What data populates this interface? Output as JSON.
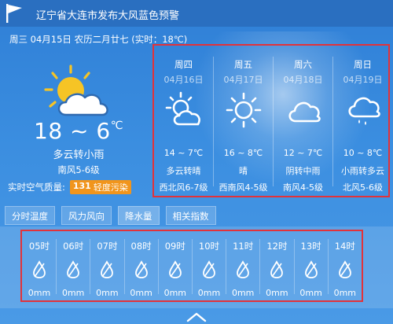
{
  "header": {
    "alert": "辽宁省大连市发布大风蓝色预警",
    "logo_icon": "pennant-flag-icon"
  },
  "date_line": "周三 04月15日 农历二月廿七 (实时：18℃)",
  "today": {
    "icon": "sun-behind-cloud-icon",
    "temp_low_high": "18 ~ 6",
    "unit": "℃",
    "condition": "多云转小雨",
    "wind": "南风5-6级",
    "aqi_label": "实时空气质量:",
    "aqi_value": "131",
    "aqi_level": "轻度污染",
    "aqi_color": "#f1951c"
  },
  "forecast": [
    {
      "weekday": "周四",
      "date": "04月16日",
      "icon": "partly-sunny-icon",
      "temp": "14 ~ 7℃",
      "condition": "多云转晴",
      "wind": "西北风6-7级"
    },
    {
      "weekday": "周五",
      "date": "04月17日",
      "icon": "sun-icon",
      "temp": "16 ~ 8℃",
      "condition": "晴",
      "wind": "西南风4-5级"
    },
    {
      "weekday": "周六",
      "date": "04月18日",
      "icon": "cloud-icon",
      "temp": "12 ~ 7℃",
      "condition": "阴转中雨",
      "wind": "南风4-5级"
    },
    {
      "weekday": "周日",
      "date": "04月19日",
      "icon": "cloud-rain-icon",
      "temp": "10 ~ 8℃",
      "condition": "小雨转多云",
      "wind": "北风5-6级"
    }
  ],
  "tabs": [
    {
      "label": "分时温度"
    },
    {
      "label": "风力风向"
    },
    {
      "label": "降水量"
    },
    {
      "label": "相关指数"
    }
  ],
  "active_tab": 2,
  "hourly": [
    {
      "hour": "05时",
      "value": "0mm"
    },
    {
      "hour": "06时",
      "value": "0mm"
    },
    {
      "hour": "07时",
      "value": "0mm"
    },
    {
      "hour": "08时",
      "value": "0mm"
    },
    {
      "hour": "09时",
      "value": "0mm"
    },
    {
      "hour": "10时",
      "value": "0mm"
    },
    {
      "hour": "11时",
      "value": "0mm"
    },
    {
      "hour": "12时",
      "value": "0mm"
    },
    {
      "hour": "13时",
      "value": "0mm"
    },
    {
      "hour": "14时",
      "value": "0mm"
    }
  ],
  "colors": {
    "highlight_border": "#e2323a",
    "background": "#3b8ee0",
    "sun": "#f6c425"
  }
}
